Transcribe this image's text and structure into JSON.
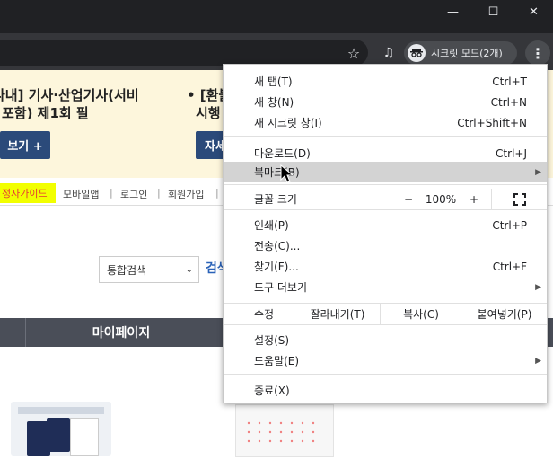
{
  "window": {
    "minimize_glyph": "—",
    "maximize_glyph": "☐",
    "close_glyph": "✕"
  },
  "toolbar": {
    "star_icon": "☆",
    "media_icon": "♫",
    "incognito_label": "시크릿 모드(2개)",
    "menu_icon": "⋮"
  },
  "page": {
    "banner_left_line1": "나내] 기사·산업기사(서비",
    "banner_left_line2": "포함) 제1회 필",
    "banner_left_button": "보기 +",
    "banner_right_line1": "• [환불",
    "banner_right_line2": "시행",
    "banner_right_button": "자세",
    "guide_link": "정자가이드",
    "links": [
      "모바일앱",
      "로그인",
      "회원가입"
    ],
    "search_select": "통합검색",
    "search_button": "검색",
    "nav_mypage": "마이페이지"
  },
  "menu": {
    "new_tab": {
      "label": "새 탭(T)",
      "shortcut": "Ctrl+T"
    },
    "new_window": {
      "label": "새 창(N)",
      "shortcut": "Ctrl+N"
    },
    "new_incognito": {
      "label": "새 시크릿 창(I)",
      "shortcut": "Ctrl+Shift+N"
    },
    "downloads": {
      "label": "다운로드(D)",
      "shortcut": "Ctrl+J"
    },
    "bookmarks": {
      "label": "북마크(B)"
    },
    "zoom": {
      "label": "글꼴 크기",
      "minus": "−",
      "value": "100%",
      "plus": "+"
    },
    "print": {
      "label": "인쇄(P)",
      "shortcut": "Ctrl+P"
    },
    "cast": {
      "label": "전송(C)..."
    },
    "find": {
      "label": "찾기(F)...",
      "shortcut": "Ctrl+F"
    },
    "more_tools": {
      "label": "도구 더보기"
    },
    "edit": {
      "label": "수정",
      "cut": "잘라내기(T)",
      "copy": "복사(C)",
      "paste": "붙여넣기(P)"
    },
    "settings": {
      "label": "설정(S)"
    },
    "help": {
      "label": "도움말(E)"
    },
    "exit": {
      "label": "종료(X)"
    }
  }
}
